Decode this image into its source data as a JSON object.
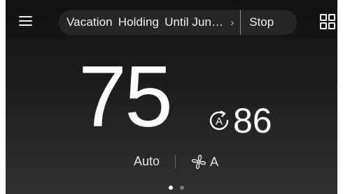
{
  "header": {
    "menu_icon": "hamburger-menu-icon",
    "grid_icon": "grid-apps-icon"
  },
  "banner": {
    "status": "Vacation",
    "state": "Holding",
    "until": "Until Jun…",
    "chevron": "›",
    "stop_label": "Stop"
  },
  "thermostat": {
    "current_temp": "75",
    "setpoint_temp": "86",
    "mode_icon": "auto-mode-icon"
  },
  "controls": {
    "hvac_mode": "Auto",
    "fan_icon": "fan-icon",
    "fan_mode": "A"
  },
  "pager": {
    "pages": 2,
    "active_index": 0
  },
  "colors": {
    "background_top": "#121212",
    "background_bottom": "#303030",
    "banner_bg": "#262626",
    "text": "#ffffff",
    "dot_active": "#ffffff",
    "dot_inactive": "#7a7a7a"
  }
}
